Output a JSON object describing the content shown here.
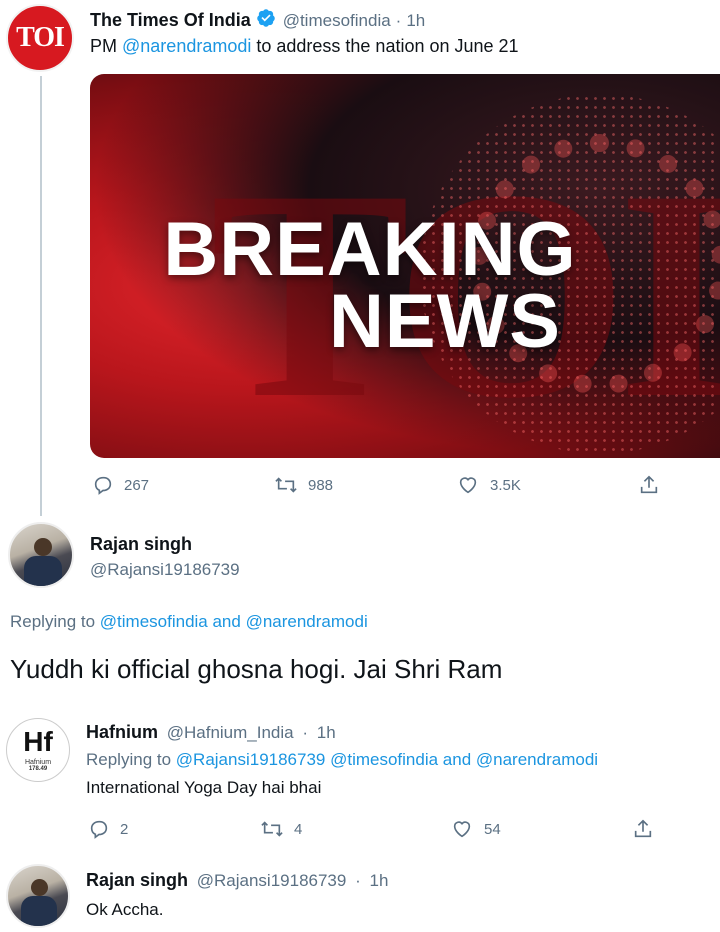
{
  "tweet1": {
    "avatar_text": "TOI",
    "name": "The Times Of India",
    "handle": "@timesofindia",
    "sep": "·",
    "time": "1h",
    "text_pre": "PM ",
    "mention": "@narendramodi",
    "text_post": " to address the nation on June 21",
    "image": {
      "line1": "BREAKING",
      "line2": "NEWS",
      "bg_letters": "TOI"
    },
    "replies": "267",
    "retweets": "988",
    "likes": "3.5K"
  },
  "tweet2": {
    "name": "Rajan singh",
    "handle": "@Rajansi19186739",
    "replying_label": "Replying to ",
    "replying_to_1": "@timesofindia",
    "replying_and": " and ",
    "replying_to_2": "@narendramodi",
    "text": "Yuddh ki official ghosna hogi. Jai Shri Ram"
  },
  "tweet3": {
    "avatar_symbol": "Hf",
    "avatar_name": "Hafnium",
    "avatar_mass": "178.49",
    "name": "Hafnium",
    "handle": "@Hafnium_India",
    "sep": "·",
    "time": "1h",
    "replying_label": "Replying to ",
    "replying_to_1": "@Rajansi19186739",
    "replying_to_2": "@timesofindia",
    "replying_and": " and ",
    "replying_to_3": "@narendramodi",
    "text": "International Yoga Day hai bhai",
    "replies": "2",
    "retweets": "4",
    "likes": "54"
  },
  "tweet4": {
    "name": "Rajan singh",
    "handle": "@Rajansi19186739",
    "sep": "·",
    "time": "1h",
    "text": "Ok Accha."
  },
  "colors": {
    "link": "#1b95e0",
    "muted": "#5b7083",
    "toi_red": "#d71920",
    "verified": "#1da1f2"
  },
  "icons": [
    "reply-icon",
    "retweet-icon",
    "like-icon",
    "share-icon",
    "verified-badge-icon"
  ]
}
